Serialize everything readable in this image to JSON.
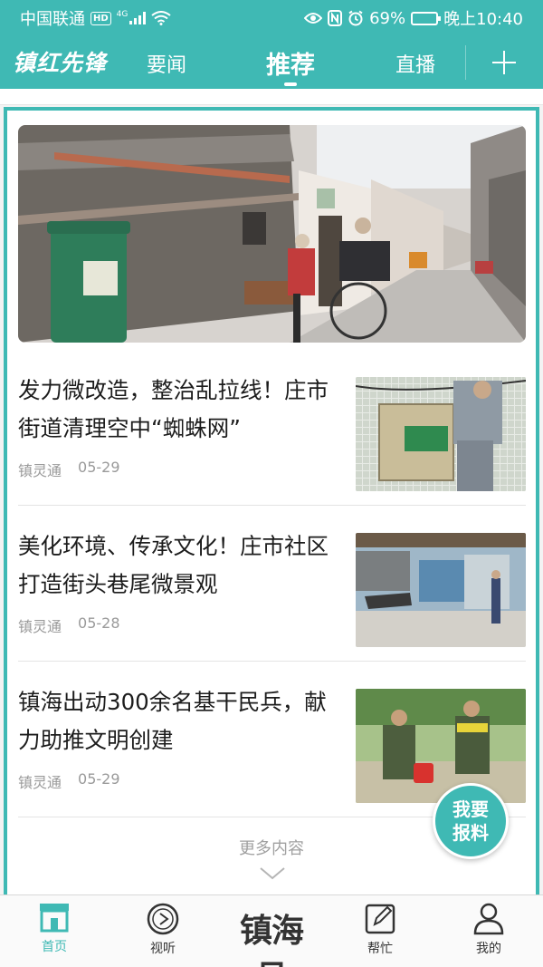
{
  "status_bar": {
    "carrier": "中国联通",
    "hd": "HD",
    "network": "4G",
    "battery": "69%",
    "battery_level": 0.69,
    "time": "晚上10:40"
  },
  "top_nav": {
    "logo": "镇红先锋",
    "tabs": [
      "要闻",
      "推荐",
      "直播"
    ],
    "active_tab": "推荐"
  },
  "news": [
    {
      "title": "发力微改造，整治乱拉线！庄市街道清理空中“蜘蛛网”",
      "source": "镇灵通",
      "date": "05-29"
    },
    {
      "title": "美化环境、传承文化！庄市社区打造街头巷尾微景观",
      "source": "镇灵通",
      "date": "05-28"
    },
    {
      "title": "镇海出动300余名基干民兵，献力助推文明创建",
      "source": "镇灵通",
      "date": "05-29"
    }
  ],
  "more_label": "更多内容",
  "report_button": {
    "line1": "我要",
    "line2": "报料"
  },
  "bottom_nav": {
    "items": [
      "首页",
      "视听",
      "帮忙",
      "我的"
    ],
    "center": "镇海号",
    "active": "首页"
  },
  "colors": {
    "accent": "#3fb9b4"
  }
}
